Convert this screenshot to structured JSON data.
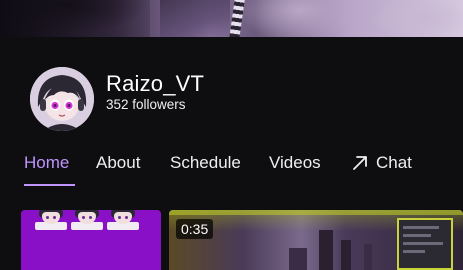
{
  "channel": {
    "name": "Raizo_VT",
    "followers": "352 followers"
  },
  "tabs": [
    {
      "label": "Home",
      "active": true
    },
    {
      "label": "About"
    },
    {
      "label": "Schedule"
    },
    {
      "label": "Videos"
    },
    {
      "label": "Chat",
      "icon": "external-arrow-icon"
    }
  ],
  "videos": [
    {
      "duration": ""
    },
    {
      "duration": "0:35"
    }
  ],
  "colors": {
    "accent": "#bf94ff",
    "background": "#0e0e10",
    "card_purple": "#8a10c8"
  }
}
